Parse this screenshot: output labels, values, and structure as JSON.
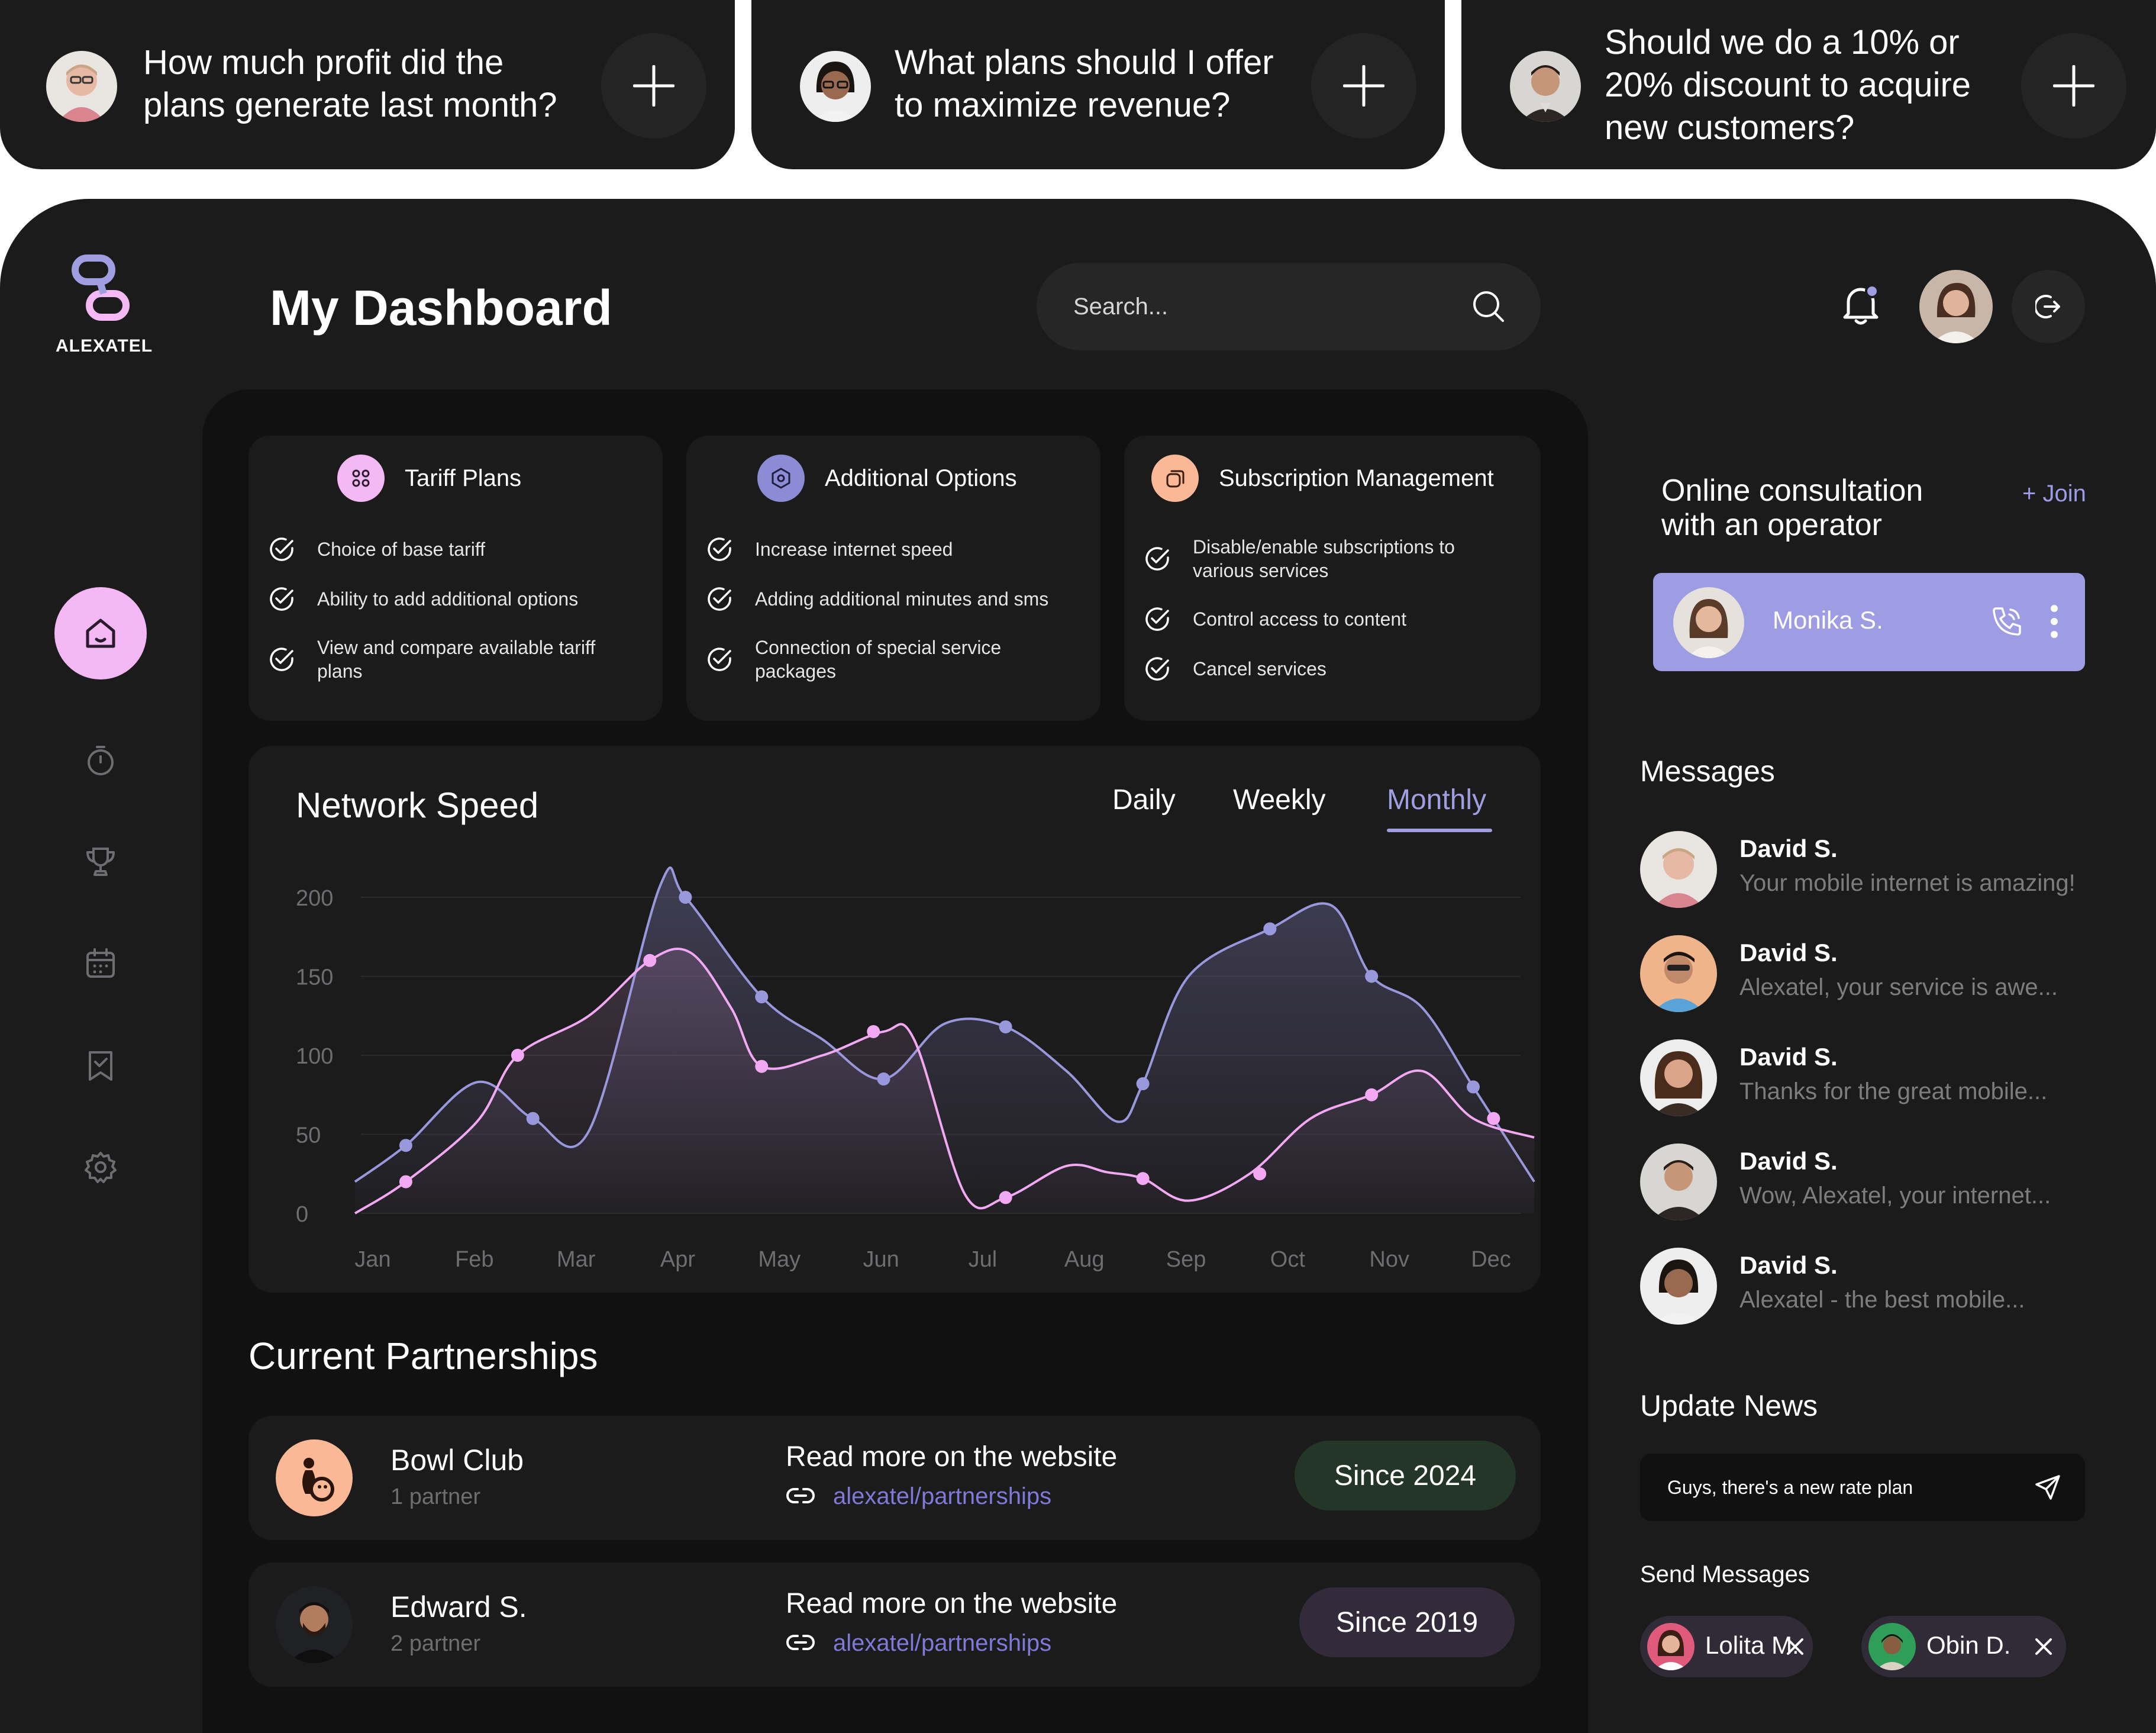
{
  "questions": [
    {
      "line1": "How much profit did the",
      "line2": "plans generate last month?",
      "line3": ""
    },
    {
      "line1": "What plans should I offer",
      "line2": "to maximize revenue?",
      "line3": ""
    },
    {
      "line1": "Should we do a 10% or",
      "line2": "20% discount to acquire",
      "line3": "new customers?"
    }
  ],
  "brand": {
    "name": "ALEXATEL",
    "accent": "#a09ee0",
    "pink": "#f4b8f5",
    "peach": "#fbb896"
  },
  "header": {
    "title": "My Dashboard",
    "search_placeholder": "Search..."
  },
  "features": [
    {
      "title": "Tariff Plans",
      "icon": "grid-dots-icon",
      "items": [
        {
          "l1": "Choice of base tariff",
          "l2": ""
        },
        {
          "l1": "Ability to add additional options",
          "l2": ""
        },
        {
          "l1": "View and compare available tariff",
          "l2": "plans"
        }
      ]
    },
    {
      "title": "Additional Options",
      "icon": "hexagon-icon",
      "items": [
        {
          "l1": "Increase internet speed",
          "l2": ""
        },
        {
          "l1": "Adding additional minutes and sms",
          "l2": ""
        },
        {
          "l1": "Connection of special service",
          "l2": "packages"
        }
      ]
    },
    {
      "title": "Subscription Management",
      "icon": "layers-icon",
      "items": [
        {
          "l1": "Disable/enable subscriptions to",
          "l2": "various services"
        },
        {
          "l1": "Control access to content",
          "l2": ""
        },
        {
          "l1": "Cancel services",
          "l2": ""
        }
      ]
    }
  ],
  "chart_data": {
    "type": "line",
    "title": "Network Speed",
    "categories": [
      "Jan",
      "Feb",
      "Mar",
      "Apr",
      "May",
      "Jun",
      "Jul",
      "Aug",
      "Sep",
      "Oct",
      "Nov",
      "Dec"
    ],
    "y_ticks": [
      "200",
      "150",
      "100",
      "50",
      "0"
    ],
    "ylim": [
      0,
      200
    ],
    "grid": true,
    "series": [
      {
        "color": "#9a98dc",
        "points": [
          [
            0,
            20
          ],
          [
            0.5,
            43
          ],
          [
            1.2,
            83
          ],
          [
            1.75,
            60
          ],
          [
            2.3,
            52
          ],
          [
            3,
            207
          ],
          [
            3.25,
            200
          ],
          [
            4,
            137
          ],
          [
            4.6,
            110
          ],
          [
            5.2,
            85
          ],
          [
            5.8,
            120
          ],
          [
            6.4,
            118
          ],
          [
            7,
            90
          ],
          [
            7.5,
            58
          ],
          [
            7.75,
            82
          ],
          [
            8.2,
            150
          ],
          [
            9,
            180
          ],
          [
            9.6,
            195
          ],
          [
            10,
            150
          ],
          [
            10.5,
            130
          ],
          [
            11,
            80
          ],
          [
            11.6,
            20
          ]
        ]
      },
      {
        "color": "#f3a8f4",
        "points": [
          [
            0,
            0
          ],
          [
            0.5,
            20
          ],
          [
            1.2,
            58
          ],
          [
            1.6,
            100
          ],
          [
            2.3,
            125
          ],
          [
            2.9,
            160
          ],
          [
            3.3,
            165
          ],
          [
            3.7,
            130
          ],
          [
            4,
            93
          ],
          [
            4.6,
            100
          ],
          [
            5.2,
            115
          ],
          [
            5.5,
            110
          ],
          [
            6,
            12
          ],
          [
            6.4,
            10
          ],
          [
            7,
            30
          ],
          [
            7.4,
            26
          ],
          [
            7.75,
            22
          ],
          [
            8.2,
            8
          ],
          [
            8.8,
            25
          ],
          [
            9.4,
            60
          ],
          [
            10,
            75
          ],
          [
            10.5,
            90
          ],
          [
            11,
            60
          ],
          [
            11.6,
            48
          ]
        ]
      }
    ],
    "markers": [
      {
        "s": 0,
        "x": 0.5,
        "y": 43
      },
      {
        "s": 0,
        "x": 1.75,
        "y": 60
      },
      {
        "s": 0,
        "x": 3.25,
        "y": 200
      },
      {
        "s": 0,
        "x": 4.0,
        "y": 137
      },
      {
        "s": 0,
        "x": 5.2,
        "y": 85
      },
      {
        "s": 0,
        "x": 6.4,
        "y": 118
      },
      {
        "s": 0,
        "x": 7.75,
        "y": 82
      },
      {
        "s": 0,
        "x": 9.0,
        "y": 180
      },
      {
        "s": 0,
        "x": 10.0,
        "y": 150
      },
      {
        "s": 0,
        "x": 11.0,
        "y": 80
      },
      {
        "s": 1,
        "x": 0.5,
        "y": 20
      },
      {
        "s": 1,
        "x": 1.6,
        "y": 100
      },
      {
        "s": 1,
        "x": 2.9,
        "y": 160
      },
      {
        "s": 1,
        "x": 4.0,
        "y": 93
      },
      {
        "s": 1,
        "x": 5.1,
        "y": 115
      },
      {
        "s": 1,
        "x": 6.4,
        "y": 10
      },
      {
        "s": 1,
        "x": 7.75,
        "y": 22
      },
      {
        "s": 1,
        "x": 8.9,
        "y": 25
      },
      {
        "s": 1,
        "x": 10.0,
        "y": 75
      },
      {
        "s": 1,
        "x": 11.2,
        "y": 60
      }
    ]
  },
  "chart_tabs": {
    "daily": "Daily",
    "weekly": "Weekly",
    "monthly": "Monthly"
  },
  "partnerships": {
    "title": "Current Partnerships",
    "rows": [
      {
        "name": "Bowl Club",
        "sub": "1 partner",
        "read": "Read more on the website",
        "link": "alexatel/partnerships",
        "since": "Since 2024",
        "since_bg": "#233628"
      },
      {
        "name": "Edward S.",
        "sub": "2 partner",
        "read": "Read more on the website",
        "link": "alexatel/partnerships",
        "since": "Since 2019",
        "since_bg": "#332a3a"
      }
    ]
  },
  "consultation": {
    "line1": "Online consultation",
    "line2": "with an operator",
    "join": "+ Join",
    "operator": "Monika S."
  },
  "messages": {
    "title": "Messages",
    "items": [
      {
        "name": "David S.",
        "text": "Your mobile internet is amazing!"
      },
      {
        "name": "David S.",
        "text": "Alexatel, your service is awe..."
      },
      {
        "name": "David S.",
        "text": "Thanks for the great mobile..."
      },
      {
        "name": "David S.",
        "text": "Wow, Alexatel, your internet..."
      },
      {
        "name": "David S.",
        "text": "Alexatel - the best mobile..."
      }
    ]
  },
  "news": {
    "title": "Update News",
    "value": "Guys, there's a new rate plan"
  },
  "send": {
    "title": "Send Messages",
    "chips": [
      "Lolita M.",
      "Obin D."
    ]
  }
}
